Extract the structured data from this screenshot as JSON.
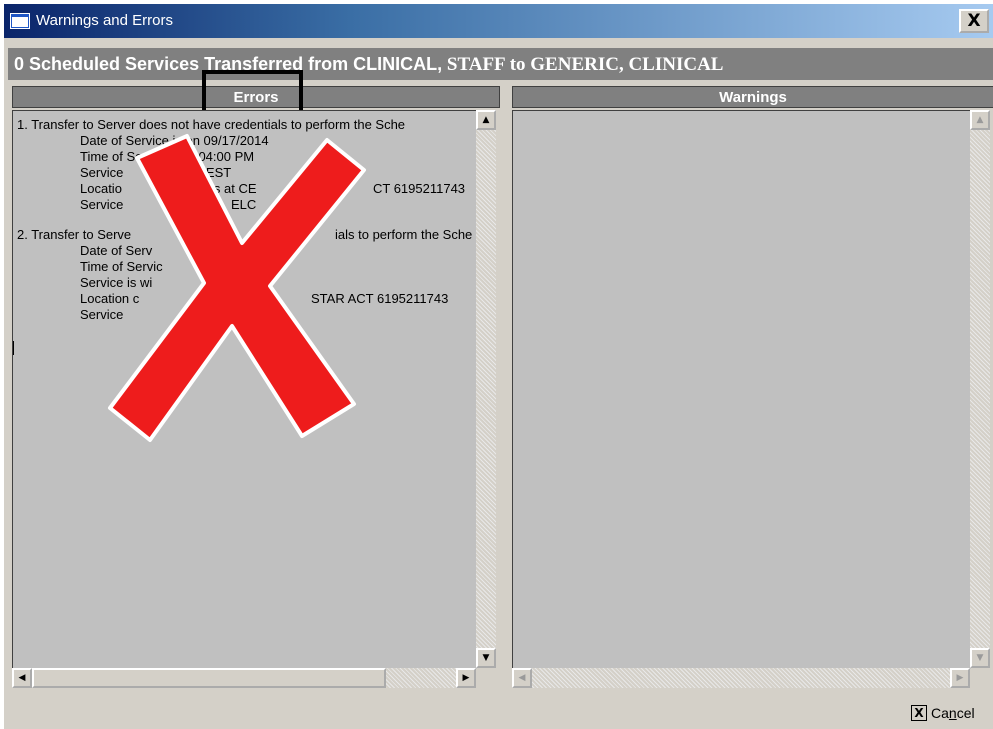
{
  "window": {
    "title": "Warnings and Errors",
    "close_label": "X"
  },
  "headline": {
    "part1": "0 Scheduled Services Transferred from CLINICAL,",
    "part2": " STAFF to GENERIC, CLINICAL"
  },
  "errors_panel": {
    "header": "Errors",
    "lines": [
      "1.  Transfer to Server does not have credentials to perform the Sche",
      "Date of Service is on 09/17/2014",
      "Time of Ser",
      "is at 04:00 PM",
      "Service",
      ", TEST",
      "Locatio",
      "is at CE",
      "CT 6195211743",
      "Service",
      "ELC",
      "2.  Transfer to Serve",
      "ials to perform the Sche",
      "Date of Serv",
      "4",
      "Time of Servic",
      "Service is wi",
      "Location c",
      "STAR ACT 6195211743",
      "Service"
    ]
  },
  "warnings_panel": {
    "header": "Warnings"
  },
  "scroll_glyphs": {
    "up": "▲",
    "down": "▼",
    "left": "◀",
    "right": "▶"
  },
  "cancel": {
    "label": "Cancel",
    "x_glyph": "X"
  },
  "colors": {
    "x_mark": "#ee1c1c",
    "title_gradient_start": "#0a246a"
  }
}
